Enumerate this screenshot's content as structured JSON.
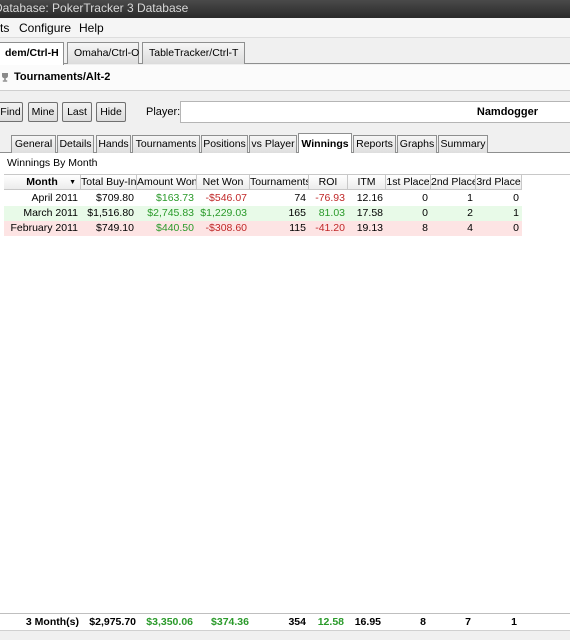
{
  "window": {
    "title": "Database: PokerTracker 3 Database"
  },
  "menu": {
    "items": [
      "ts",
      "Configure",
      "Help"
    ]
  },
  "game_tabs": [
    {
      "label": "dem/Ctrl-H",
      "active": true
    },
    {
      "label": "Omaha/Ctrl-O",
      "active": false
    },
    {
      "label": "TableTracker/Ctrl-T",
      "active": false
    }
  ],
  "mode_tab": {
    "label": "Tournaments/Alt-2"
  },
  "toolbar": {
    "find_label": "Find",
    "mine_label": "Mine",
    "last_label": "Last",
    "hide_label": "Hide",
    "player_label": "Player:",
    "player_value": "Namdogger"
  },
  "stat_tabs": [
    {
      "label": "General",
      "active": false
    },
    {
      "label": "Details",
      "active": false
    },
    {
      "label": "Hands",
      "active": false
    },
    {
      "label": "Tournaments",
      "active": false
    },
    {
      "label": "Positions",
      "active": false
    },
    {
      "label": "vs Player",
      "active": false
    },
    {
      "label": "Winnings",
      "active": true
    },
    {
      "label": "Reports",
      "active": false
    },
    {
      "label": "Graphs",
      "active": false
    },
    {
      "label": "Summary",
      "active": false
    }
  ],
  "section": {
    "title": "Winnings By Month"
  },
  "table": {
    "columns": [
      "Month",
      "Total Buy-In",
      "Amount Won",
      "Net Won",
      "Tournaments",
      "ROI",
      "ITM",
      "1st Place",
      "2nd Place",
      "3rd Place"
    ],
    "sort_indicator": "▼",
    "rows": [
      {
        "bg": "#ffffff",
        "cells": [
          "April 2011",
          "$709.80",
          "$163.73",
          "-$546.07",
          "74",
          "-76.93",
          "12.16",
          "0",
          "1",
          "0"
        ]
      },
      {
        "bg": "#e8fae8",
        "cells": [
          "March 2011",
          "$1,516.80",
          "$2,745.83",
          "$1,229.03",
          "165",
          "81.03",
          "17.58",
          "0",
          "2",
          "1"
        ]
      },
      {
        "bg": "#fde4e4",
        "cells": [
          "February 2011",
          "$749.10",
          "$440.50",
          "-$308.60",
          "115",
          "-41.20",
          "19.13",
          "8",
          "4",
          "0"
        ]
      }
    ],
    "totals": [
      "3 Month(s)",
      "$2,975.70",
      "$3,350.06",
      "$374.36",
      "354",
      "12.58",
      "16.95",
      "8",
      "7",
      "1"
    ]
  },
  "colors": {
    "positive": "#2a9a2a",
    "negative": "#c02828"
  }
}
